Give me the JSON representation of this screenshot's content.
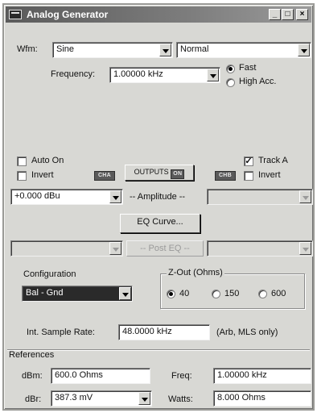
{
  "window": {
    "title": "Analog Generator"
  },
  "title_buttons": {
    "minimize": "_",
    "maximize": "□",
    "close": "×"
  },
  "waveform": {
    "label": "Wfm:",
    "value": "Sine",
    "mode": "Normal"
  },
  "frequency": {
    "label": "Frequency:",
    "value": "1.00000 kHz"
  },
  "mode_radio": {
    "fast": "Fast",
    "high_acc": "High Acc.",
    "selected": "fast"
  },
  "left_channel": {
    "auto_on": "Auto On",
    "invert": "Invert",
    "chip": "CHA"
  },
  "outputs": {
    "label": "OUTPUTS",
    "state": "ON"
  },
  "right_channel": {
    "track_a": "Track A",
    "invert": "Invert",
    "chip": "CHB",
    "track_checked": true
  },
  "amplitude": {
    "value": "+0.000  dBu",
    "label": "-- Amplitude --",
    "right_value": ""
  },
  "eq": {
    "button": "EQ Curve...",
    "post_eq": "-- Post EQ --"
  },
  "configuration": {
    "label": "Configuration",
    "value": "Bal - Gnd"
  },
  "zout": {
    "label": "Z-Out (Ohms)",
    "options": [
      "40",
      "150",
      "600"
    ],
    "selected": "40"
  },
  "sample_rate": {
    "label": "Int. Sample Rate:",
    "value": "48.0000 kHz",
    "note": "(Arb, MLS only)"
  },
  "references": {
    "label": "References",
    "dbm_label": "dBm:",
    "dbm_value": "600.0    Ohms",
    "freq_label": "Freq:",
    "freq_value": "1.00000 kHz",
    "dbr_label": "dBr:",
    "dbr_value": "387.3  mV",
    "watts_label": "Watts:",
    "watts_value": "8.000    Ohms"
  }
}
